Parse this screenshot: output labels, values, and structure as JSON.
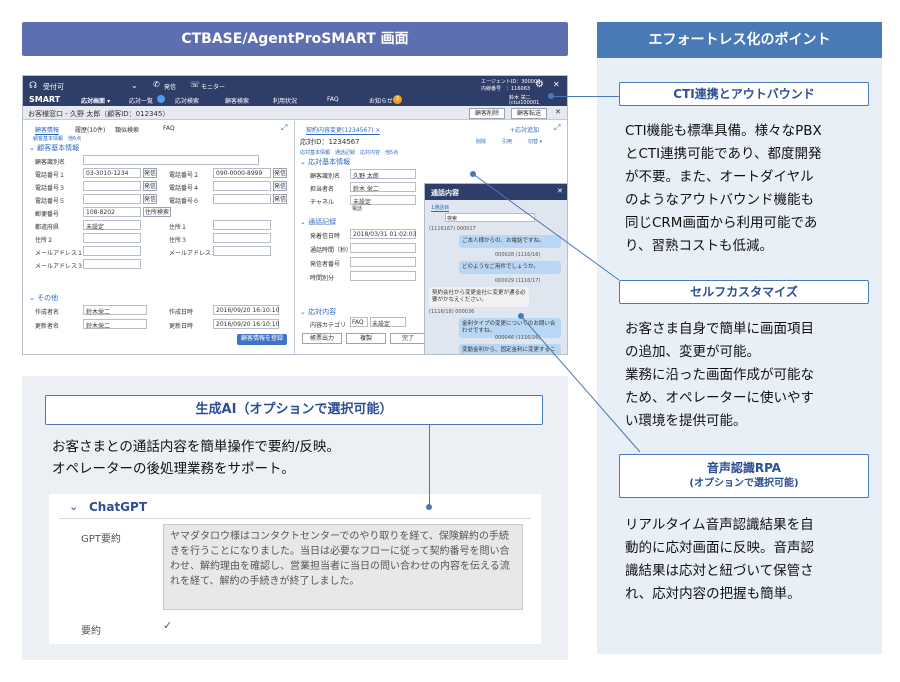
{
  "left_title": "CTBASE/AgentProSMART 画面",
  "right_title": "エフォートレス化のポイント",
  "points": [
    {
      "title": "CTI連携とアウトバウンド",
      "subtitle": "",
      "lines": [
        "CTI機能も標準具備。様々なPBX",
        "とCTI連携可能であり、都度開発",
        "が不要。また、オートダイヤル",
        "のようなアウトバウンド機能も",
        "同じCRM画面から利用可能であ",
        "り、習熟コストも低減。"
      ]
    },
    {
      "title": "セルフカスタマイズ",
      "subtitle": "",
      "lines": [
        "お客さま自身で簡単に画面項目",
        "の追加、変更が可能。",
        "業務に沿った画面作成が可能な",
        "ため、オペレーターに使いやす",
        "い環境を提供可能。"
      ]
    },
    {
      "title": "音声認識RPA",
      "subtitle": "(オプションで選択可能)",
      "lines": [
        "リアルタイム音声認識結果を自",
        "動的に応対画面に反映。音声認",
        "識結果は応対と紐づいて保管さ",
        "れ、応対内容の把握も簡単。"
      ]
    }
  ],
  "genai": {
    "title": "生成AI（オプションで選択可能）",
    "lines": [
      "お客さまとの通話内容を簡単操作で要約/反映。",
      "オペレーターの後処理業務をサポート。"
    ],
    "section": "ChatGPT",
    "summary_label": "GPT要約",
    "summary_text": "ヤマダタロウ様はコンタクトセンターでのやり取りを経て、保険解約の手続きを行うことになりました。当日は必要なフローに従って契約番号を問い合わせ、解約理由を確認し、営業担当者に当日の問い合わせの内容を伝える流れを経て、解約の手続きが終了しました。",
    "checkbox_label": "要約"
  },
  "shot": {
    "status": "受付可",
    "hdr_items": [
      "発信",
      "モニター"
    ],
    "ext_info": [
      "エージェントID：300006",
      "内線番号　：116063"
    ],
    "user": "鈴木 栄二",
    "user_id": "(ctui100001",
    "logo": "SMART",
    "nav": [
      "応対画面 ▾",
      "応対一覧",
      "応対検索",
      "顧客検索",
      "利用状況",
      "FAQ",
      "お知らせ"
    ],
    "nav_badge": "3",
    "customer_title": "お客様窓口 - 久野 太郎（顧客ID：012345）",
    "customer_buttons": [
      "顧客削除",
      "顧客転送"
    ],
    "left_tabs": [
      "顧客情報",
      "履歴(10件)",
      "類似検索",
      "FAQ"
    ],
    "left_sub": "顧客基本情報　他6点",
    "sect_basic": "顧客基本情報",
    "fields": [
      {
        "l": "顧客識別名",
        "v": ""
      },
      {
        "l": "電話番号１",
        "v": "03-3010-1234",
        "l2": "電話番号２",
        "v2": "090-0000-8999"
      },
      {
        "l": "電話番号３",
        "v": "",
        "l2": "電話番号４",
        "v2": ""
      },
      {
        "l": "電話番号５",
        "v": "",
        "l2": "電話番号６",
        "v2": ""
      },
      {
        "l": "郵便番号",
        "v": "108-8202",
        "l2": "",
        "v2": ""
      },
      {
        "l": "都道府県",
        "v": "未設定",
        "l2": "住所１",
        "v2": ""
      },
      {
        "l": "住所２",
        "v": "",
        "l2": "住所３",
        "v2": ""
      },
      {
        "l": "メールアドレス１",
        "v": "",
        "l2": "メールアドレス２",
        "v2": ""
      },
      {
        "l": "メールアドレス３",
        "v": ""
      }
    ],
    "call_btn": "発信",
    "addr_btn": "住所検索",
    "sect_other": "その他",
    "other_fields": [
      {
        "l": "作成者名",
        "v": "鈴木栄二",
        "l2": "作成日時",
        "v2": "2016/09/20 16:10:10"
      },
      {
        "l": "更新者名",
        "v": "鈴木栄二",
        "l2": "更新日時",
        "v2": "2016/09/20 16:10:10"
      }
    ],
    "register_btn": "顧客情報を登録",
    "mid_tab": "契約内容変更(1234567) ×",
    "mid_add": "+応対追加",
    "incident": "応対ID：1234567",
    "mid_icons": [
      "削除",
      "引用",
      "切替 ▾"
    ],
    "mid_sub": "応対基本情報　通話記録　応対内容　他5点",
    "mid_sect1": "応対基本情報",
    "mid_fields": [
      {
        "l": "顧客識別名",
        "v": "久野 太郎"
      },
      {
        "l": "担当者名",
        "v": "鈴木 栄二"
      },
      {
        "l": "チャネル",
        "v": "未設定"
      }
    ],
    "channel_opts": [
      "電話"
    ],
    "mid_sect2": "通話記録",
    "call_fields": [
      {
        "l": "発着信日時",
        "v": "2018/03/31 01:02:03"
      },
      {
        "l": "通話時間（秒）",
        "v": ""
      },
      {
        "l": "発信者番号",
        "v": ""
      },
      {
        "l": "時間別分",
        "v": ""
      }
    ],
    "mid_sect3": "応対内容",
    "category_label": "内容カテゴリ",
    "category_values": [
      "FAQ",
      "未設定"
    ],
    "mid_buttons": [
      "帳票出力",
      "複製",
      "完了"
    ],
    "chat_title": "通話内容",
    "chat_tab": "1通話目",
    "chat_search": "検索",
    "chat_msgs": [
      {
        "side": "meta",
        "text": "(1116167) 000027"
      },
      {
        "side": "right",
        "text": "ご本人様からの、お電話ですね。"
      },
      {
        "side": "meta-r",
        "text": "000028 (1116/16)"
      },
      {
        "side": "right",
        "text": "どのようなご用件でしょうか。"
      },
      {
        "side": "meta-r",
        "text": "000029 (1116/17)"
      },
      {
        "side": "left",
        "text": "契約会社から変更金社に変更が通る必要がかなえください。"
      },
      {
        "side": "meta",
        "text": "(1116/18) 000036"
      },
      {
        "side": "right",
        "text": "金利タイプの変更についてのお問い合わせですね。"
      },
      {
        "side": "meta-r",
        "text": "000046 (1116/26)"
      },
      {
        "side": "right",
        "text": "変動金利から、固定金利に変更すること"
      }
    ]
  }
}
